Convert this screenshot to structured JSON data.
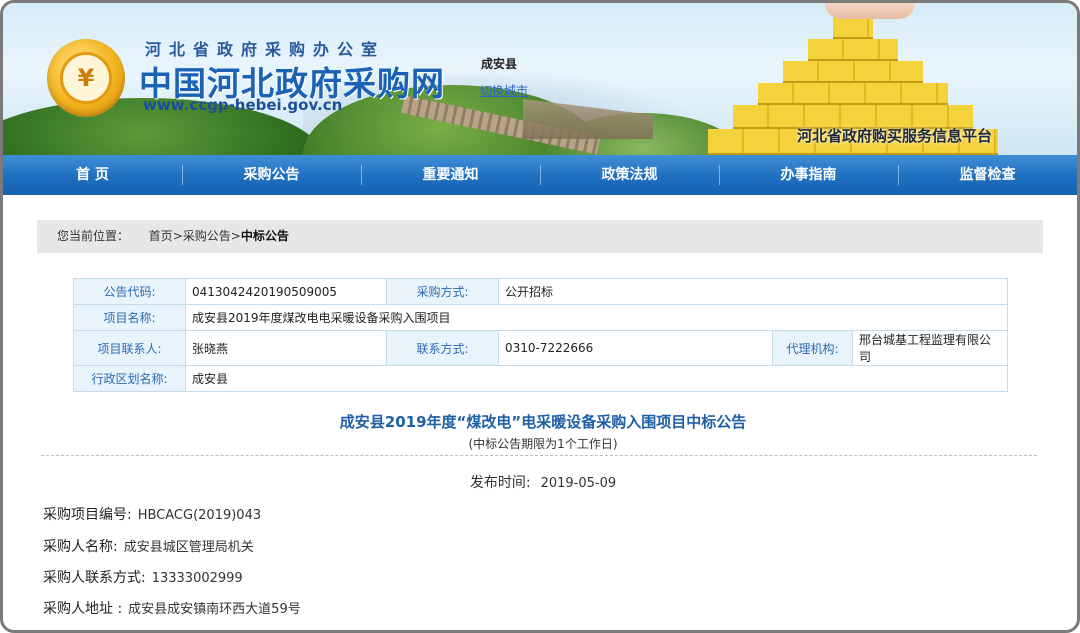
{
  "header": {
    "office": "河北省政府采购办公室",
    "title": "中国河北政府采购网",
    "url": "www.ccgp-hebei.gov.cn",
    "region": "成安县",
    "switch_city": "切换城市",
    "platform": "河北省政府购买服务信息平台"
  },
  "nav": {
    "items": [
      "首 页",
      "采购公告",
      "重要通知",
      "政策法规",
      "办事指南",
      "监督检查"
    ]
  },
  "breadcrumb": {
    "prefix": "您当前位置：",
    "home": "首页",
    "sep": ">",
    "section": "采购公告",
    "current": "中标公告"
  },
  "info": {
    "code_label": "公告代码:",
    "code_value": "0413042420190509005",
    "method_label": "采购方式:",
    "method_value": "公开招标",
    "project_label": "项目名称:",
    "project_value": "成安县2019年度煤改电电采暖设备采购入围项目",
    "contact_label": "项目联系人:",
    "contact_value": "张晓燕",
    "phone_label": "联系方式:",
    "phone_value": "0310-7222666",
    "agency_label": "代理机构:",
    "agency_value": "邢台城基工程监理有限公司",
    "district_label": "行政区划名称:",
    "district_value": "成安县"
  },
  "notice": {
    "title": "成安县2019年度“煤改电”电采暖设备采购入围项目中标公告",
    "subtitle": "(中标公告期限为1个工作日)",
    "publish_label": "发布时间:",
    "publish_date": "2019-05-09"
  },
  "details": {
    "number_label": "采购项目编号:",
    "number_value": "HBCACG(2019)043",
    "buyer_label": "采购人名称:",
    "buyer_value": "成安县城区管理局机关",
    "buyer_phone_label": "采购人联系方式:",
    "buyer_phone_value": "13333002999",
    "address_label": "采购人地址 :",
    "address_value": "成安县成安镇南环西大道59号"
  }
}
